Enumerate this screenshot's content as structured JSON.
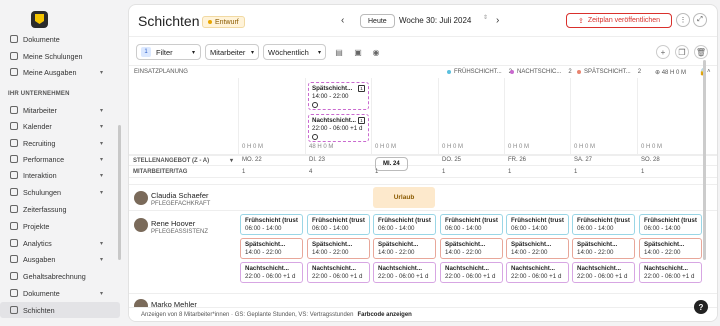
{
  "sidebar": {
    "items_top": [
      {
        "label": "Dokumente",
        "icon": "document-icon"
      },
      {
        "label": "Meine Schulungen",
        "icon": "training-icon"
      },
      {
        "label": "Meine Ausgaben",
        "icon": "expenses-icon",
        "chev": "▾"
      }
    ],
    "section": "IHR UNTERNEHMEN",
    "items": [
      {
        "label": "Mitarbeiter",
        "icon": "users-icon",
        "chev": "▾"
      },
      {
        "label": "Kalender",
        "icon": "calendar-icon",
        "chev": "▾"
      },
      {
        "label": "Recruiting",
        "icon": "recruiting-icon",
        "chev": "▾"
      },
      {
        "label": "Performance",
        "icon": "performance-icon",
        "chev": "▾"
      },
      {
        "label": "Interaktion",
        "icon": "chat-icon",
        "chev": "▾"
      },
      {
        "label": "Schulungen",
        "icon": "training-icon",
        "chev": "▾"
      },
      {
        "label": "Zeiterfassung",
        "icon": "clock-icon"
      },
      {
        "label": "Projekte",
        "icon": "folder-icon"
      },
      {
        "label": "Analytics",
        "icon": "analytics-icon",
        "chev": "▾"
      },
      {
        "label": "Ausgaben",
        "icon": "expenses-icon",
        "chev": "▾"
      },
      {
        "label": "Gehaltsabrechnung",
        "icon": "payroll-icon"
      },
      {
        "label": "Dokumente",
        "icon": "document-icon",
        "chev": "▾"
      },
      {
        "label": "Schichten",
        "icon": "shifts-icon",
        "active": true
      }
    ]
  },
  "header": {
    "title": "Schichten",
    "draft": "Entwurf",
    "today": "Heute",
    "week": "Woche 30: Juli 2024",
    "publish": "Zeitplan veröffentlichen"
  },
  "toolbar": {
    "filter_count": "1",
    "filter_label": "Filter",
    "group_label": "Mitarbeiter",
    "range_label": "Wöchentlich"
  },
  "plan": {
    "header": "EINSATZPLANUNG",
    "legend": [
      {
        "label": "FRÜHSCHICHT...",
        "count": "2",
        "color": "#5bc0de"
      },
      {
        "label": "NACHTSCHIC...",
        "count": "2",
        "color": "#c969cf"
      },
      {
        "label": "SPÄTSCHICHT...",
        "count": "2",
        "color": "#e8846f"
      }
    ],
    "total": "⊕ 48 H 0 M",
    "open_shifts": [
      {
        "title": "Spätschicht...",
        "time": "14:00 - 22:00",
        "badge": "1"
      },
      {
        "title": "Nachtschicht...",
        "time": "22:00 - 06:00 +1 d",
        "badge": "1"
      }
    ],
    "hours": [
      "0 H 0 M",
      "48 H 0 M",
      "0 H 0 M",
      "0 H 0 M",
      "0 H 0 M",
      "0 H 0 M",
      "0 H 0 M"
    ]
  },
  "positions_label": "STELLENANGEBOT (Z - A)",
  "staff_label": "MITARBEITER/TAG",
  "days": [
    {
      "label": "MO. 22",
      "count": "1"
    },
    {
      "label": "DI. 23",
      "count": "4"
    },
    {
      "label": "MI. 24",
      "count": "1"
    },
    {
      "label": "DO. 25",
      "count": "1"
    },
    {
      "label": "FR. 26",
      "count": "1"
    },
    {
      "label": "SA. 27",
      "count": "1"
    },
    {
      "label": "SO. 28",
      "count": "1"
    }
  ],
  "employees": [
    {
      "name": "Claudia Schaefer",
      "role": "PFLEGEFACHKRAFT",
      "vacation": "Urlaub"
    },
    {
      "name": "Rene Hoover",
      "role": "PFLEGEASSISTENZ",
      "early": {
        "title": "Frühschicht (trusted)",
        "time": "06:00 - 14:00"
      },
      "late": {
        "title": "Spätschicht...",
        "time": "14:00 - 22:00"
      },
      "night": {
        "title": "Nachtschicht...",
        "time": "22:00 - 06:00 +1 d"
      }
    },
    {
      "name": "Marko Mehler",
      "role": ""
    }
  ],
  "footer": {
    "text": "Anzeigen von 8 Mitarbeiter*innen · GS: Geplante Stunden, VS: Vertragsstunden",
    "link": "Farbcode anzeigen"
  }
}
